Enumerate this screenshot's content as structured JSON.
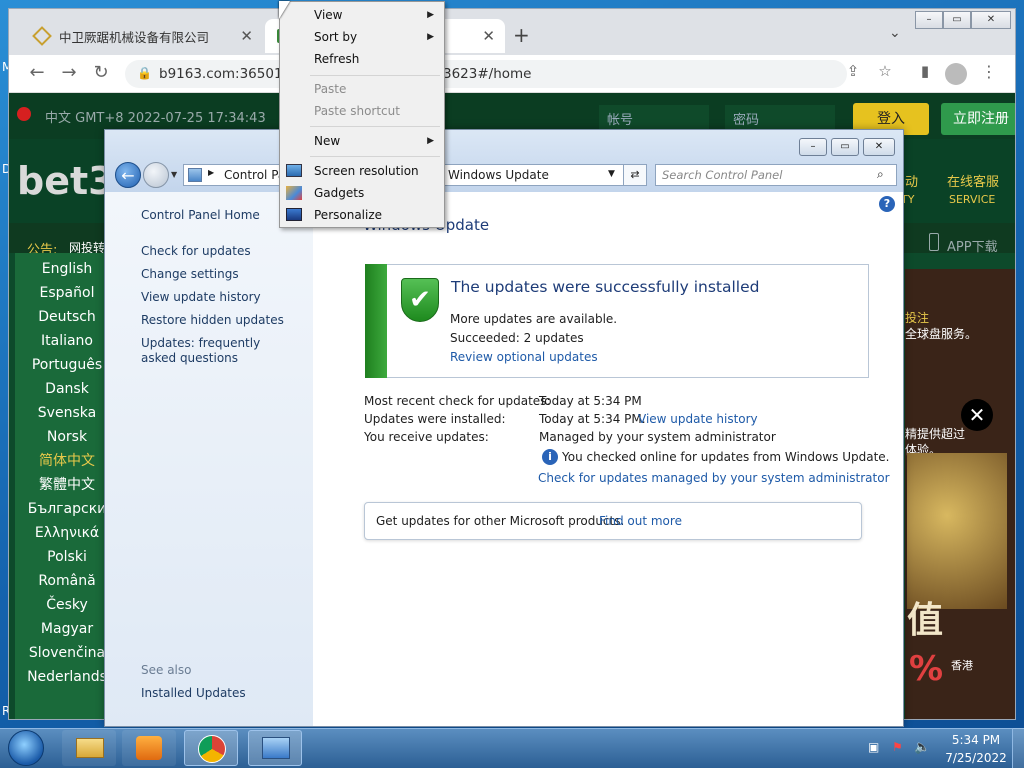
{
  "desktop": {
    "left_letters": [
      "M",
      "D",
      "Re"
    ]
  },
  "browser": {
    "tabs": [
      {
        "label": "中卫厥踞机械设备有限公司"
      },
      {
        "label": ""
      }
    ],
    "new_tab": "+",
    "address": "b9163.com:36501/?",
    "address_tail": "3623#/home"
  },
  "site": {
    "lang_time": "中文 GMT+8 2022-07-25 17:34:43",
    "account_placeholder": "帐号",
    "password_placeholder": "密码",
    "login_label": "登入",
    "register_label": "立即注册",
    "logo": "bet3",
    "nav_partial": "动",
    "nav_partial_sub": "TY",
    "support_label": "在线客服",
    "support_sub": "SERVICE",
    "notice_label": "公告:",
    "notice_text": "网投转",
    "app_download": "APP下载",
    "languages": [
      "English",
      "Español",
      "Deutsch",
      "Italiano",
      "Português",
      "Dansk",
      "Svenska",
      "Norsk",
      "简体中文",
      "繁體中文",
      "Български",
      "Ελληνικά",
      "Polski",
      "Română",
      "Česky",
      "Magyar",
      "Slovenčina",
      "Nederlands"
    ],
    "right_texts": [
      "投注",
      "全球盘服务。",
      "精提供超过",
      "体验。"
    ],
    "ad_value": "值",
    "ad_percent": "%",
    "ad_tag": "香港"
  },
  "windows_update": {
    "breadcrumb_1": "Control Pa",
    "breadcrumb_2": "Windows Update",
    "search_placeholder": "Search Control Panel",
    "title": "Windows Update",
    "sidebar": {
      "home": "Control Panel Home",
      "links": [
        "Check for updates",
        "Change settings",
        "View update history",
        "Restore hidden updates",
        "Updates: frequently asked questions"
      ],
      "see_also": "See also",
      "installed": "Installed Updates"
    },
    "status": {
      "headline": "The updates were successfully installed",
      "more": "More updates are available.",
      "succeeded": "Succeeded: 2 updates",
      "review": "Review optional updates"
    },
    "info": [
      {
        "label": "Most recent check for updates:",
        "value": "Today at 5:34 PM"
      },
      {
        "label": "Updates were installed:",
        "value": "Today at 5:34 PM.",
        "link": "View update history"
      },
      {
        "label": "You receive updates:",
        "value": "Managed by your system administrator"
      }
    ],
    "online_note": "You checked online for updates from Windows Update.",
    "admin_link": "Check for updates managed by your system administrator",
    "ms_products": "Get updates for other Microsoft products.",
    "find_out": "Find out more"
  },
  "context_menu": {
    "items": [
      {
        "label": "View",
        "submenu": true,
        "disabled": false
      },
      {
        "label": "Sort by",
        "submenu": true,
        "disabled": false
      },
      {
        "label": "Refresh",
        "submenu": false,
        "disabled": false
      },
      {
        "label": "Paste",
        "submenu": false,
        "disabled": true
      },
      {
        "label": "Paste shortcut",
        "submenu": false,
        "disabled": true
      },
      {
        "label": "New",
        "submenu": true,
        "disabled": false
      },
      {
        "label": "Screen resolution",
        "icon": "monitor-icon"
      },
      {
        "label": "Gadgets",
        "icon": "gadgets-icon"
      },
      {
        "label": "Personalize",
        "icon": "personalize-icon"
      }
    ]
  },
  "taskbar": {
    "time": "5:34 PM",
    "date": "7/25/2022"
  },
  "colors": {
    "site_green": "#0d4a2b",
    "login_yellow": "#e6c21f",
    "register_green": "#2f9a4c",
    "success_green": "#2d8a2d"
  }
}
